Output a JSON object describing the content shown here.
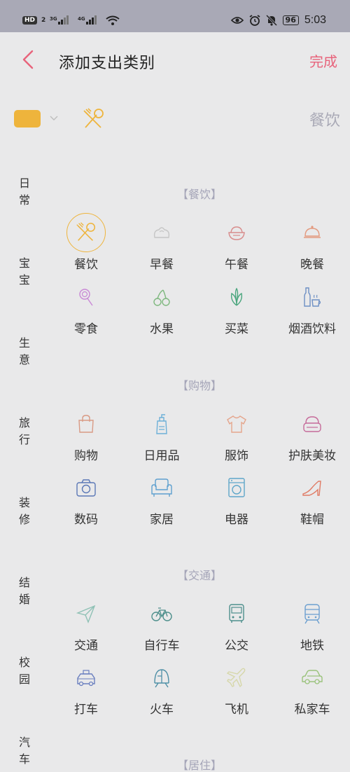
{
  "status": {
    "left": [
      "HD",
      "2",
      "3G",
      "4G"
    ],
    "battery": "96",
    "time": "5:03"
  },
  "header": {
    "title": "添加支出类别",
    "done_label": "完成"
  },
  "picker": {
    "color": "#eeb43c",
    "selected_name": "餐饮"
  },
  "side_nav": [
    {
      "label": "日常"
    },
    {
      "label": "宝宝"
    },
    {
      "label": "生意"
    },
    {
      "label": "旅行"
    },
    {
      "label": "装修"
    },
    {
      "label": "结婚"
    },
    {
      "label": "校园"
    },
    {
      "label": "汽车"
    }
  ],
  "sections": [
    {
      "title": "【餐饮】",
      "items": [
        {
          "label": "餐饮",
          "icon": "utensils-icon",
          "selected": true
        },
        {
          "label": "早餐",
          "icon": "bun-icon"
        },
        {
          "label": "午餐",
          "icon": "rice-bowl-icon"
        },
        {
          "label": "晚餐",
          "icon": "cloche-icon"
        },
        {
          "label": "零食",
          "icon": "lollipop-icon"
        },
        {
          "label": "水果",
          "icon": "cherry-icon"
        },
        {
          "label": "买菜",
          "icon": "vegetable-icon"
        },
        {
          "label": "烟酒饮料",
          "icon": "bottle-cup-icon"
        }
      ]
    },
    {
      "title": "【购物】",
      "items": [
        {
          "label": "购物",
          "icon": "shopping-bag-icon"
        },
        {
          "label": "日用品",
          "icon": "pump-bottle-icon"
        },
        {
          "label": "服饰",
          "icon": "tshirt-icon"
        },
        {
          "label": "护肤美妆",
          "icon": "cosmetics-icon"
        },
        {
          "label": "数码",
          "icon": "camera-icon"
        },
        {
          "label": "家居",
          "icon": "armchair-icon"
        },
        {
          "label": "电器",
          "icon": "washing-machine-icon"
        },
        {
          "label": "鞋帽",
          "icon": "high-heel-icon"
        }
      ]
    },
    {
      "title": "【交通】",
      "items": [
        {
          "label": "交通",
          "icon": "paper-plane-icon"
        },
        {
          "label": "自行车",
          "icon": "bicycle-icon"
        },
        {
          "label": "公交",
          "icon": "bus-icon"
        },
        {
          "label": "地铁",
          "icon": "subway-icon"
        },
        {
          "label": "打车",
          "icon": "taxi-icon"
        },
        {
          "label": "火车",
          "icon": "train-icon"
        },
        {
          "label": "飞机",
          "icon": "airplane-icon"
        },
        {
          "label": "私家车",
          "icon": "car-icon"
        }
      ]
    },
    {
      "title": "【居住】",
      "items": []
    }
  ]
}
